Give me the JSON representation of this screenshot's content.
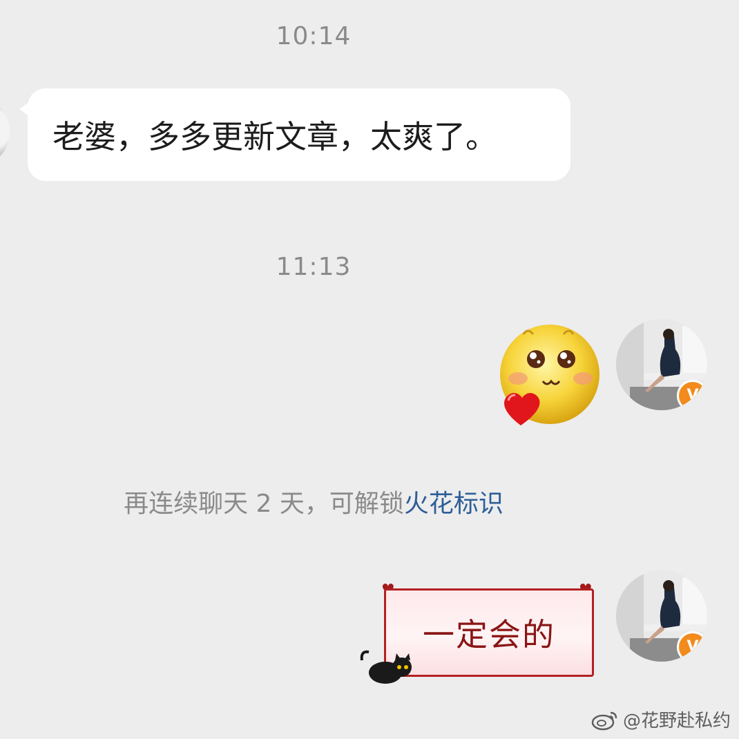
{
  "messages": {
    "time_1": "10:14",
    "incoming_text": "老婆，多多更新文章，太爽了。",
    "time_2": "11:13",
    "outgoing_sticker_text": "一定会的"
  },
  "notice": {
    "prefix": "再连续聊天 2 天，可解锁",
    "link": "火花标识"
  },
  "badge": {
    "label": "V"
  },
  "watermark": {
    "text": "@花野赴私约"
  },
  "colors": {
    "background": "#ededed",
    "bubble_in": "#ffffff",
    "link": "#2e5e98",
    "badge": "#f28b1c",
    "sticker_border": "#b32020"
  },
  "icons": [
    "emoji-love-sticker",
    "verified-badge-icon",
    "black-cat-icon",
    "weibo-logo-icon"
  ]
}
